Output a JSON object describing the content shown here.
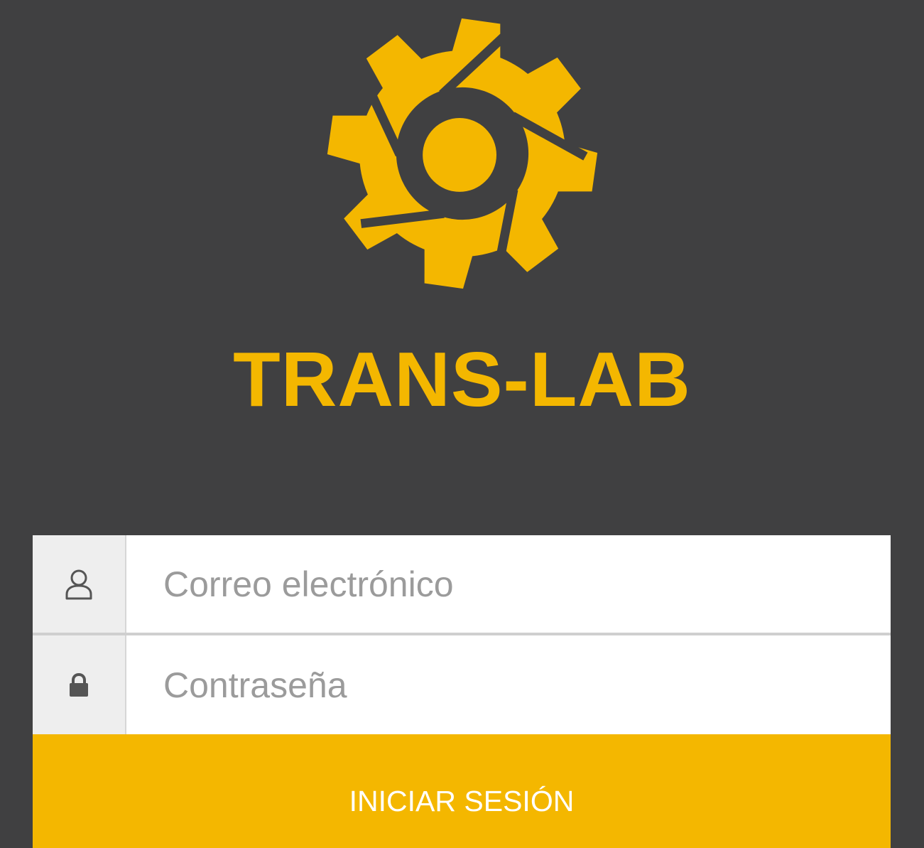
{
  "brand": {
    "name": "TRANS-LAB",
    "logo_icon": "gear-aperture-icon",
    "color": "#f4b700"
  },
  "colors": {
    "background": "#404041",
    "accent": "#f4b700",
    "field_background": "#ffffff",
    "addon_background": "#eeeeee"
  },
  "login": {
    "email": {
      "icon": "user-icon",
      "value": "",
      "placeholder": "Correo electrónico"
    },
    "password": {
      "icon": "lock-icon",
      "value": "",
      "placeholder": "Contraseña"
    },
    "submit_label": "INICIAR SESIÓN"
  }
}
